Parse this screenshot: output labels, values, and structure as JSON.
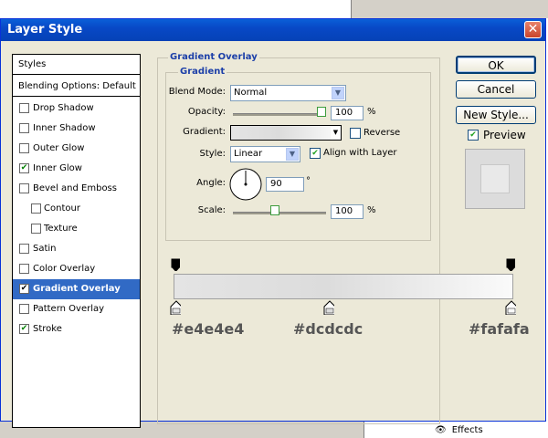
{
  "window": {
    "title": "Layer Style"
  },
  "background": {
    "effects_label": "Effects"
  },
  "styles_list": {
    "header_styles": "Styles",
    "header_blending": "Blending Options: Default",
    "items": [
      {
        "label": "Drop Shadow",
        "checked": false
      },
      {
        "label": "Inner Shadow",
        "checked": false
      },
      {
        "label": "Outer Glow",
        "checked": false
      },
      {
        "label": "Inner Glow",
        "checked": true
      },
      {
        "label": "Bevel and Emboss",
        "checked": false
      },
      {
        "label": "Contour",
        "checked": false
      },
      {
        "label": "Texture",
        "checked": false
      },
      {
        "label": "Satin",
        "checked": false
      },
      {
        "label": "Color Overlay",
        "checked": false
      },
      {
        "label": "Gradient Overlay",
        "checked": true
      },
      {
        "label": "Pattern Overlay",
        "checked": false
      },
      {
        "label": "Stroke",
        "checked": true
      }
    ]
  },
  "gradient_overlay": {
    "group_title": "Gradient Overlay",
    "sub_title": "Gradient",
    "blend_mode_label": "Blend Mode:",
    "blend_mode_value": "Normal",
    "opacity_label": "Opacity:",
    "opacity_value": "100",
    "opacity_fraction": 1.0,
    "percent": "%",
    "gradient_label": "Gradient:",
    "reverse_label": "Reverse",
    "reverse_checked": false,
    "style_label": "Style:",
    "style_value": "Linear",
    "align_label": "Align with Layer",
    "align_checked": true,
    "angle_label": "Angle:",
    "angle_value": "90",
    "degree": "°",
    "scale_label": "Scale:",
    "scale_value": "100",
    "scale_fraction": 0.45
  },
  "buttons": {
    "ok": "OK",
    "cancel": "Cancel",
    "new_style": "New Style...",
    "preview": "Preview",
    "preview_checked": true
  },
  "gradient_editor": {
    "stops": [
      {
        "color": "#e4e4e4",
        "label": "#e4e4e4"
      },
      {
        "color": "#dcdcdc",
        "label": "#dcdcdc"
      },
      {
        "color": "#fafafa",
        "label": "#fafafa"
      }
    ]
  },
  "colors": {
    "accent": "#316ac5",
    "title_bar": "#0848c6",
    "dialog_bg": "#ece9d8"
  }
}
